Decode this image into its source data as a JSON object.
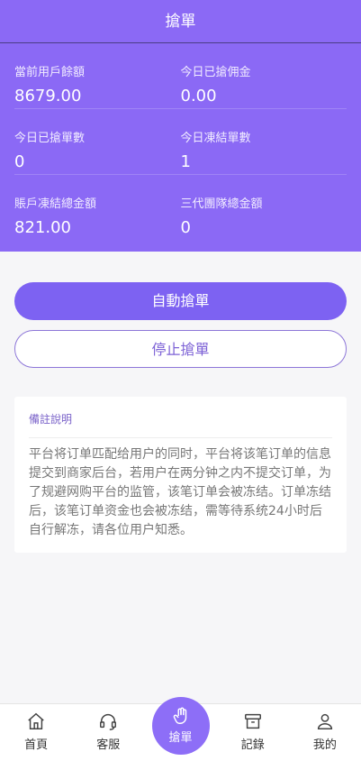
{
  "header": {
    "title": "搶單"
  },
  "stats": [
    {
      "label": "當前用戶餘額",
      "value": "8679.00"
    },
    {
      "label": "今日已搶佣金",
      "value": "0.00"
    },
    {
      "label": "今日已搶單數",
      "value": "0"
    },
    {
      "label": "今日凍結單數",
      "value": "1"
    },
    {
      "label": "賬戶凍結總金額",
      "value": "821.00"
    },
    {
      "label": "三代團隊總金額",
      "value": "0"
    }
  ],
  "actions": {
    "auto_label": "自動搶單",
    "stop_label": "停止搶單"
  },
  "note": {
    "title": "備註說明",
    "body": "平台将订单匹配给用户的同时，平台将该笔订单的信息提交到商家后台，若用户在两分钟之内不提交订单，为了规避网购平台的监管，该笔订单会被冻结。订单冻结后，该笔订单资金也会被冻结，需等待系统24小时后自行解冻，请各位用户知悉。"
  },
  "tabs": [
    {
      "label": "首頁",
      "icon": "home-icon"
    },
    {
      "label": "客服",
      "icon": "headset-icon"
    },
    {
      "label": "搶單",
      "icon": "hand-icon"
    },
    {
      "label": "記錄",
      "icon": "archive-icon"
    },
    {
      "label": "我的",
      "icon": "user-icon"
    }
  ],
  "colors": {
    "accent": "#8b69f5",
    "button": "#7d62f2"
  }
}
